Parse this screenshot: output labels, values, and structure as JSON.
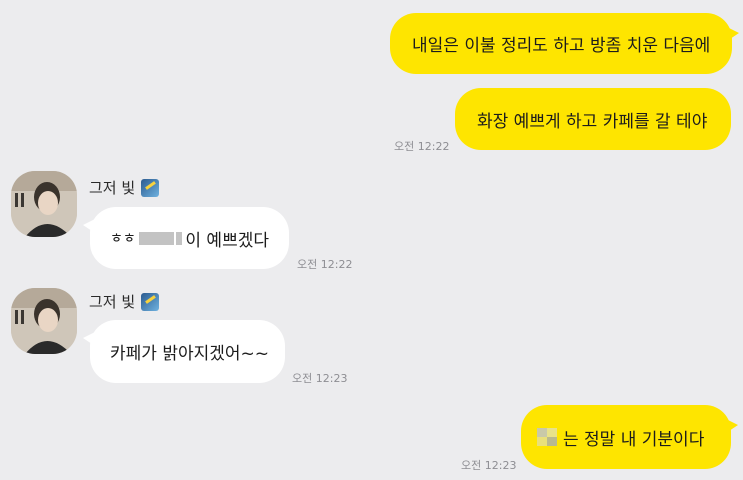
{
  "messages": {
    "m1": {
      "text": "내일은 이불 정리도 하고 방좀 치운 다음에"
    },
    "m2": {
      "text": "화장 예쁘게 하고 카페를 갈 테야",
      "time": "오전 12:22"
    },
    "m3": {
      "sender": "그저 빛",
      "prefix": "ㅎㅎ",
      "suffix": "이 예쁘겠다",
      "time": "오전 12:22"
    },
    "m4": {
      "sender": "그저 빛",
      "text": "카페가 밝아지겠어~~",
      "time": "오전 12:23"
    },
    "m5": {
      "text": "는 정말 내 기분이다",
      "time": "오전 12:23"
    }
  },
  "colors": {
    "background": "#ececee",
    "my_bubble": "#fee500",
    "their_bubble": "#ffffff",
    "timestamp": "#8e8e93"
  },
  "icons": {
    "verified_badge": "gold-feather-badge-icon"
  }
}
